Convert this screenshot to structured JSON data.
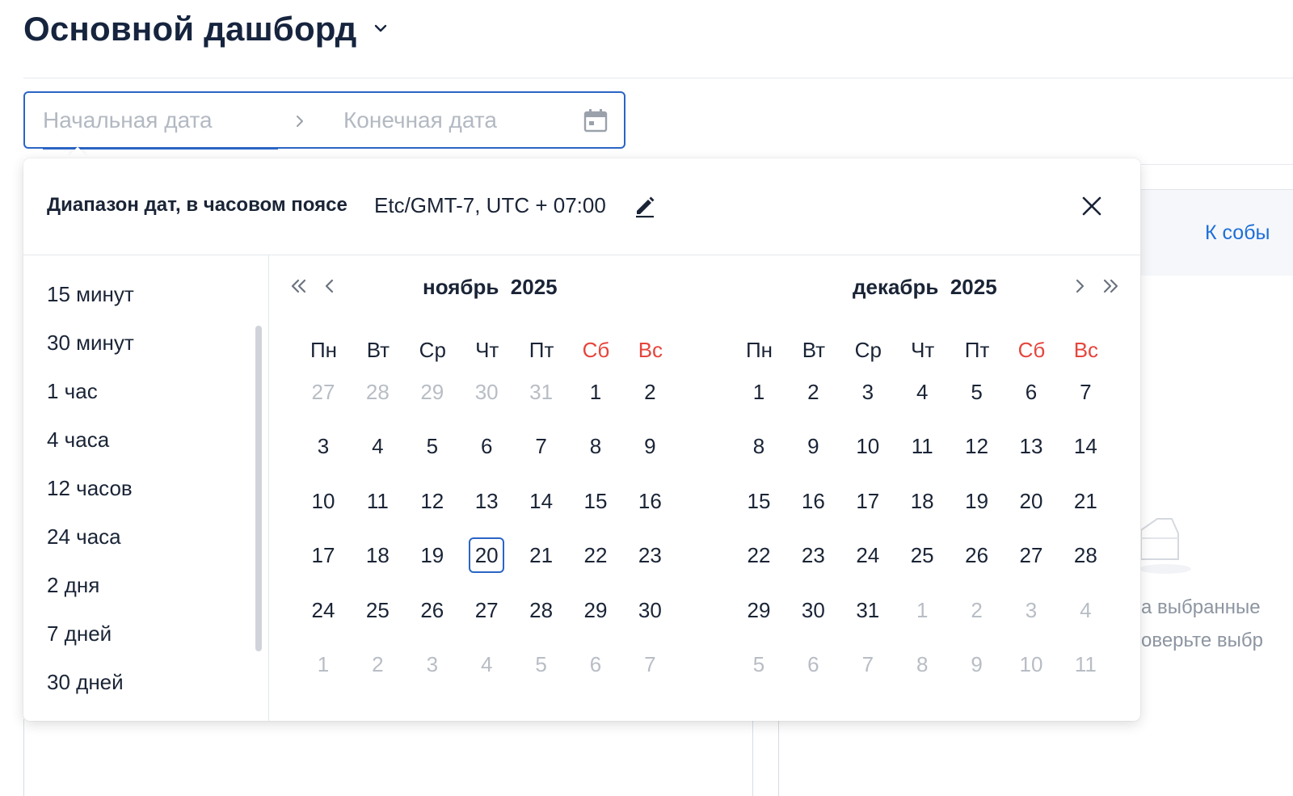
{
  "header": {
    "title": "Основной дашборд",
    "title_dropdown_icon": "chevron-down-icon"
  },
  "background": {
    "link_text": "К собы",
    "empty_line1": "а выбранные",
    "empty_line2": "оверьте выбр"
  },
  "date_range": {
    "start_placeholder": "Начальная дата",
    "end_placeholder": "Конечная дата",
    "separator_icon": "chevron-right-icon",
    "calendar_icon": "calendar-icon"
  },
  "popup": {
    "timezone_label": "Диапазон дат, в часовом поясе",
    "timezone_value": "Etc/GMT-7, UTC + 07:00",
    "edit_icon": "pencil-icon",
    "close_icon": "close-icon",
    "presets": [
      "15 минут",
      "30 минут",
      "1 час",
      "4 часа",
      "12 часов",
      "24 часа",
      "2 дня",
      "7 дней",
      "30 дней"
    ],
    "weekdays": [
      "Пн",
      "Вт",
      "Ср",
      "Чт",
      "Пт",
      "Сб",
      "Вс"
    ],
    "colors": {
      "accent": "#2b65c5",
      "weekend": "#e5453c",
      "muted": "#b8bdc5",
      "text": "#1a2436"
    },
    "months": [
      {
        "month": "ноябрь",
        "year": "2025",
        "days": [
          [
            "27",
            "28",
            "29",
            "30",
            "31",
            "1",
            "2"
          ],
          [
            "3",
            "4",
            "5",
            "6",
            "7",
            "8",
            "9"
          ],
          [
            "10",
            "11",
            "12",
            "13",
            "14",
            "15",
            "16"
          ],
          [
            "17",
            "18",
            "19",
            "20",
            "21",
            "22",
            "23"
          ],
          [
            "24",
            "25",
            "26",
            "27",
            "28",
            "29",
            "30"
          ],
          [
            "1",
            "2",
            "3",
            "4",
            "5",
            "6",
            "7"
          ]
        ],
        "current_month_range": [
          5,
          34
        ],
        "today": 24
      },
      {
        "month": "декабрь",
        "year": "2025",
        "days": [
          [
            "1",
            "2",
            "3",
            "4",
            "5",
            "6",
            "7"
          ],
          [
            "8",
            "9",
            "10",
            "11",
            "12",
            "13",
            "14"
          ],
          [
            "15",
            "16",
            "17",
            "18",
            "19",
            "20",
            "21"
          ],
          [
            "22",
            "23",
            "24",
            "25",
            "26",
            "27",
            "28"
          ],
          [
            "29",
            "30",
            "31",
            "1",
            "2",
            "3",
            "4"
          ],
          [
            "5",
            "6",
            "7",
            "8",
            "9",
            "10",
            "11"
          ]
        ],
        "current_month_range": [
          0,
          30
        ],
        "today": -1
      }
    ]
  }
}
